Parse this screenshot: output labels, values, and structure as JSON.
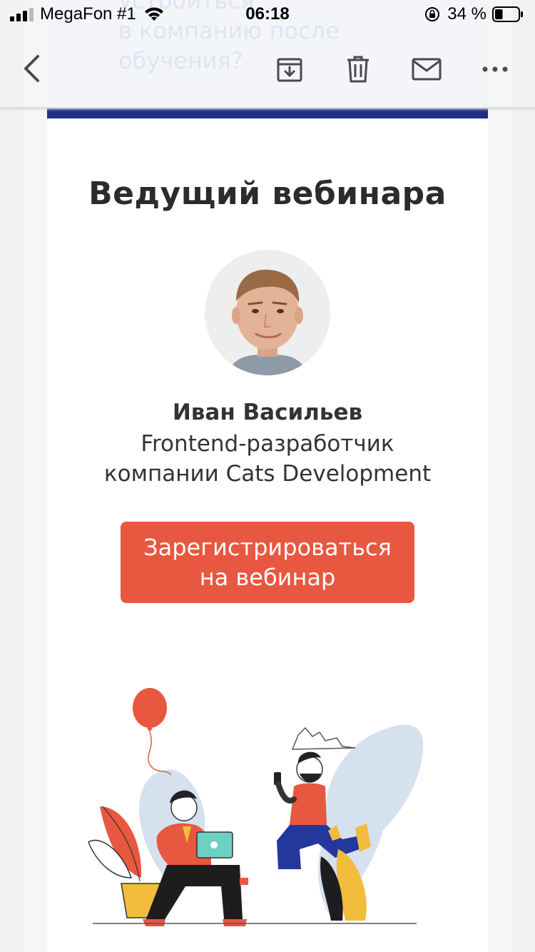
{
  "status_bar": {
    "carrier": "MegaFon #1",
    "time": "06:18",
    "battery_percent": "34 %",
    "battery_level": 0.34
  },
  "background_subject": {
    "line1": "устроиться",
    "line2": "в компанию после",
    "line3": "обучения?"
  },
  "email": {
    "heading": "Ведущий вебинара",
    "speaker_name": "Иван Васильев",
    "speaker_role_line1": "Frontend-разработчик",
    "speaker_role_line2": "компании Cats Development",
    "cta_line1": "Зарегистрироваться",
    "cta_line2": "на вебинар"
  },
  "colors": {
    "accent_button": "#e8573f",
    "brand_bar": "#1f2f86",
    "toolbar_icon": "#4a4a4a"
  }
}
